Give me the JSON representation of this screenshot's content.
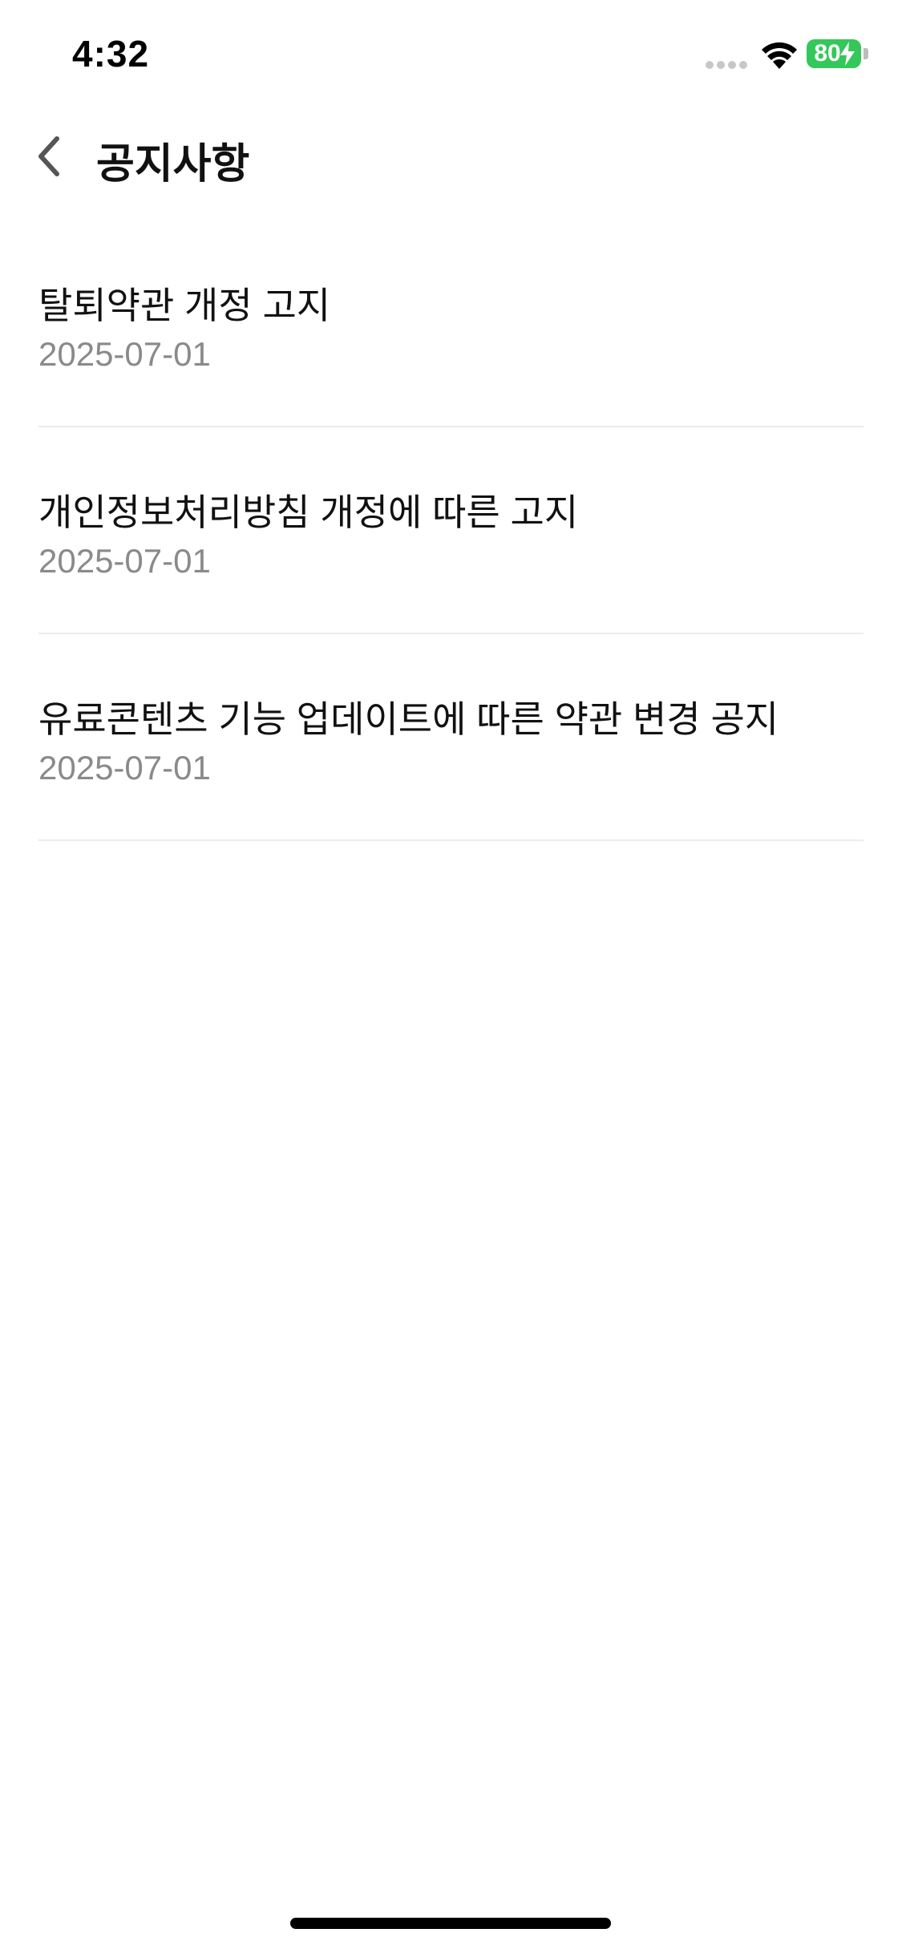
{
  "status_bar": {
    "time": "4:32",
    "battery_level": "80",
    "battery_charging": true,
    "battery_color": "#34c759"
  },
  "header": {
    "title": "공지사항",
    "back_icon": "chevron-left-icon"
  },
  "notices": [
    {
      "title": "탈퇴약관 개정 고지",
      "date": "2025-07-01"
    },
    {
      "title": "개인정보처리방침 개정에 따른 고지",
      "date": "2025-07-01"
    },
    {
      "title": "유료콘텐츠 기능 업데이트에 따른 약관 변경 공지",
      "date": "2025-07-01"
    }
  ]
}
